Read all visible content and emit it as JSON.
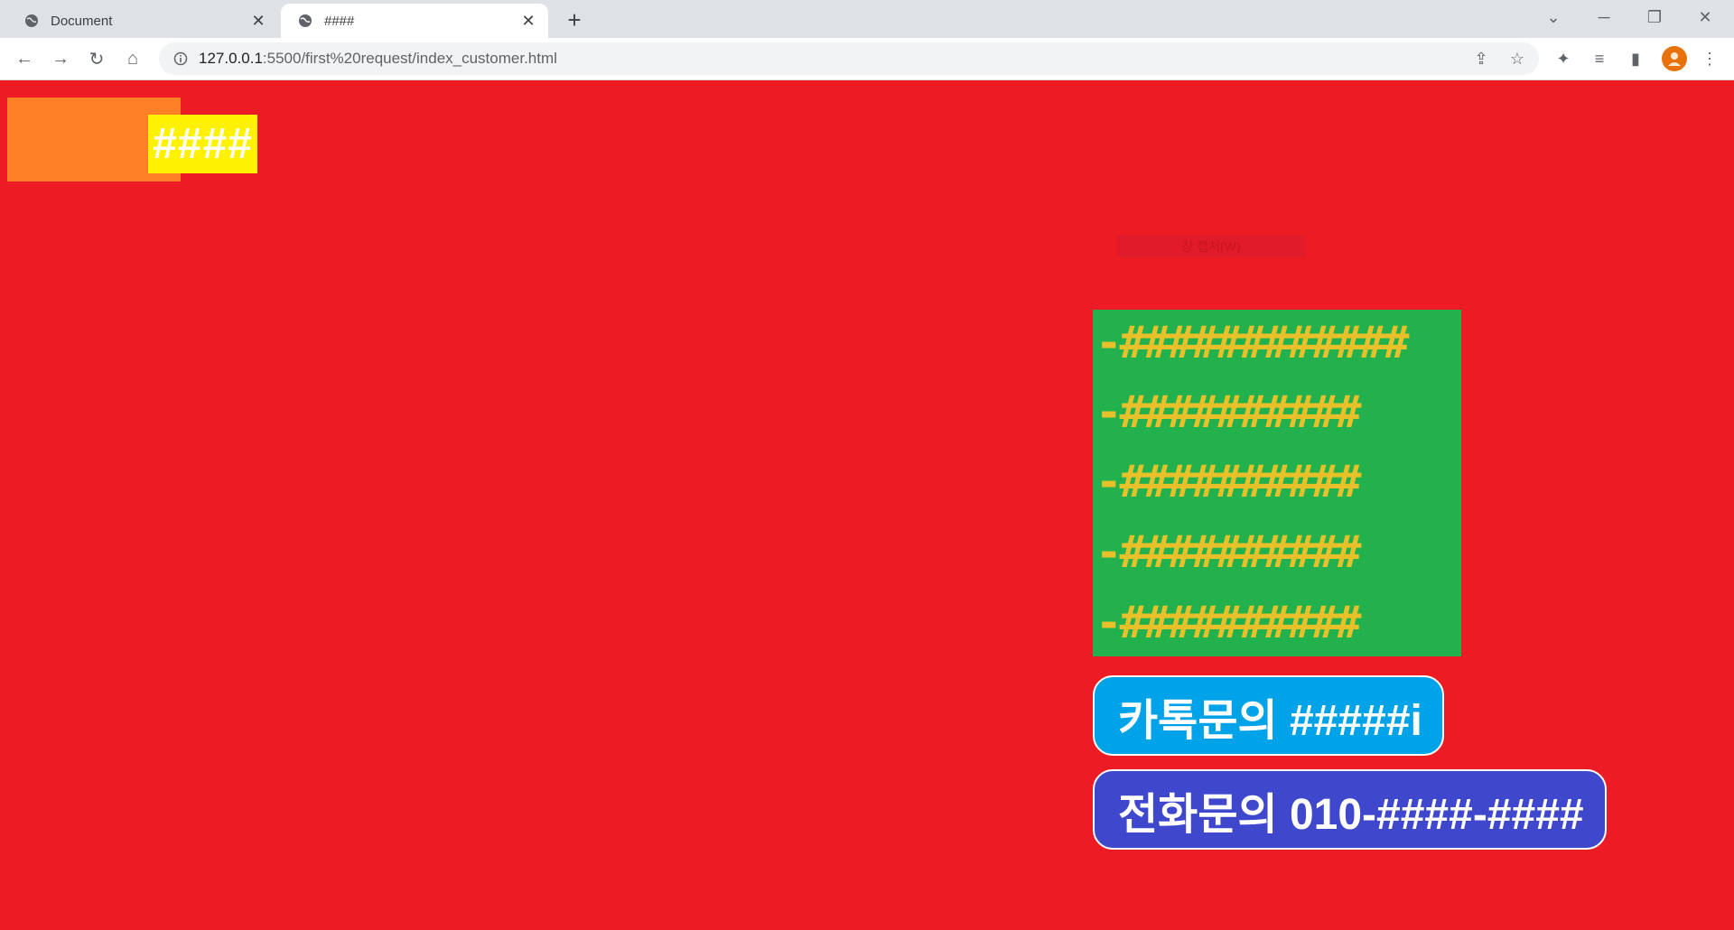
{
  "browser": {
    "tabs": [
      {
        "title": "Document",
        "active": false
      },
      {
        "title": "####",
        "active": true
      }
    ],
    "url_host": "127.0.0.1",
    "url_path": ":5500/first%20request/index_customer.html",
    "icons": [
      "globe-icon",
      "close-icon",
      "plus-icon",
      "back-icon",
      "forward-icon",
      "reload-icon",
      "home-icon",
      "info-icon",
      "share-icon",
      "star-icon",
      "extensions-icon",
      "media-icon",
      "sidepanel-icon",
      "avatar",
      "menu-icon"
    ]
  },
  "page": {
    "logo_text": "####",
    "faint_label": "창 캡처(W)",
    "menu_items": [
      "-############",
      "-##########",
      "-##########",
      "-##########",
      "-##########"
    ],
    "kakao_button": "카톡문의 #####i",
    "phone_button": "전화문의 010-####-####"
  },
  "colors": {
    "background": "#ed1c24",
    "logo_box": "#ff7f27",
    "logo_text_bg": "#fff200",
    "menu_bg": "#22b14c",
    "menu_text": "#e8c12a",
    "kakao_bg": "#00a2e8",
    "phone_bg": "#3f48cc"
  }
}
